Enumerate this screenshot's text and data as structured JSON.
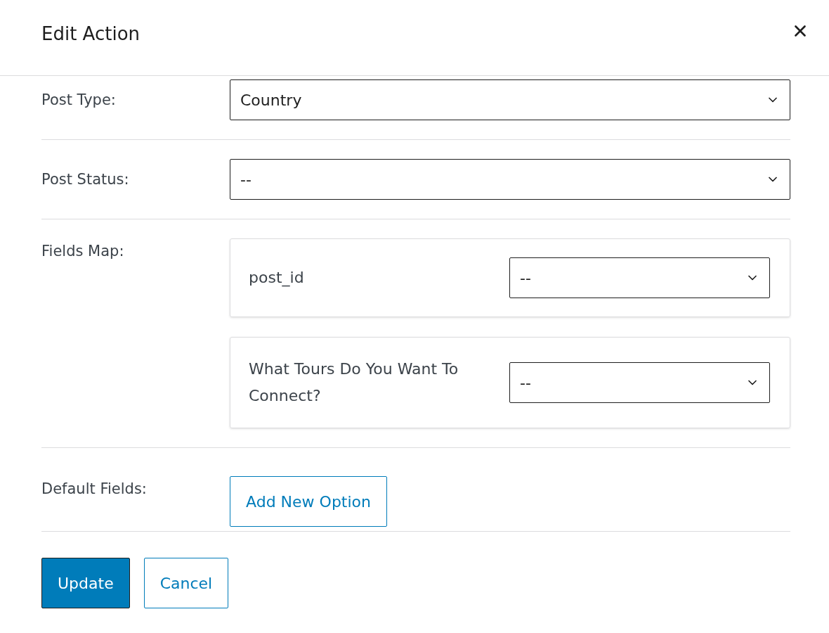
{
  "dialog": {
    "title": "Edit Action"
  },
  "rows": [
    {
      "kind": "select",
      "label": "Post Type:",
      "value": "Country"
    },
    {
      "kind": "select",
      "label": "Post Status:",
      "value": "--"
    },
    {
      "kind": "map",
      "label": "Fields Map:",
      "items": [
        {
          "name": "post_id",
          "value": "--"
        },
        {
          "name": "What Tours Do You Want To Connect?",
          "value": "--"
        }
      ]
    },
    {
      "kind": "button",
      "label": "Default Fields:",
      "button": "Add New Option"
    }
  ],
  "footer": {
    "buttons": [
      {
        "label": "Update",
        "kind": "primary"
      },
      {
        "label": "Cancel",
        "kind": "secondary"
      }
    ]
  }
}
